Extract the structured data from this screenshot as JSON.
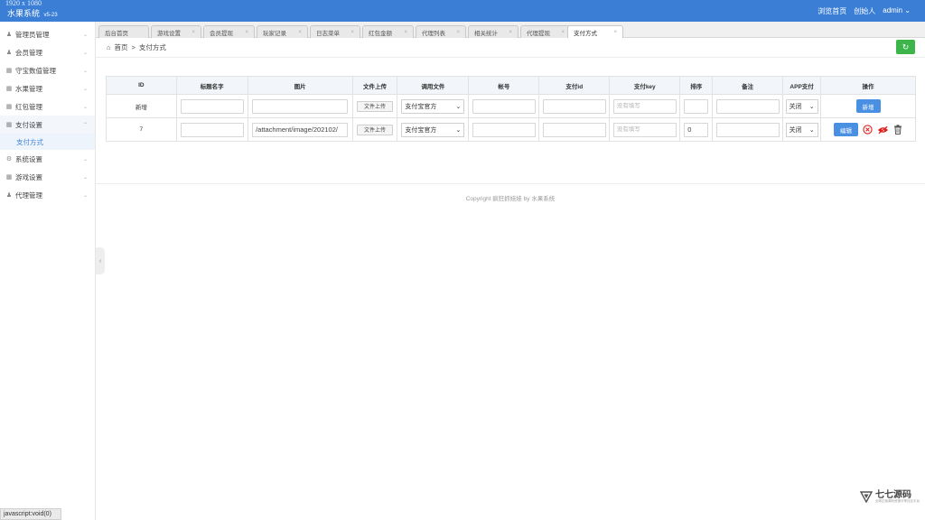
{
  "window": {
    "resolution": "1920  x  1080"
  },
  "brand": {
    "name": "水果系统",
    "version": "v5-23"
  },
  "topnav": {
    "browse_home": "浏览首页",
    "founder": "创始人",
    "user": "admin"
  },
  "sidebar": {
    "items": [
      {
        "label": "管理员管理",
        "icon": "user-icon"
      },
      {
        "label": "会员管理",
        "icon": "user-icon"
      },
      {
        "label": "守宝数值管理",
        "icon": "grid-icon"
      },
      {
        "label": "水果管理",
        "icon": "grid-icon"
      },
      {
        "label": "红包管理",
        "icon": "grid-icon"
      },
      {
        "label": "支付设置",
        "icon": "grid-icon"
      },
      {
        "label": "系统设置",
        "icon": "gear-icon"
      },
      {
        "label": "游戏设置",
        "icon": "grid-icon"
      },
      {
        "label": "代理管理",
        "icon": "user-icon"
      }
    ],
    "sub_active": "支付方式",
    "status_link": "javascript:void(0)"
  },
  "tabs": [
    "后台首页",
    "游戏设置",
    "会员提现",
    "玩家记录",
    "日志菜单",
    "红包金额",
    "代理列表",
    "相关统计",
    "代理提现",
    "支付方式"
  ],
  "breadcrumb": {
    "home": "首页",
    "sep": ">",
    "current": "支付方式"
  },
  "table": {
    "headers": [
      "ID",
      "标题名字",
      "图片",
      "文件上传",
      "调用文件",
      "帐号",
      "支付id",
      "支付key",
      "排序",
      "备注",
      "APP支付",
      "操作"
    ],
    "upload_label": "文件上传",
    "key_placeholder": "没有填写",
    "rows": [
      {
        "id": "新增",
        "title": "",
        "image": "",
        "call_file": "支付宝官方",
        "account": "",
        "pay_id": "",
        "sort": "",
        "remark": "",
        "app_pay": "关闭",
        "action": "新增"
      },
      {
        "id": "7",
        "title": "",
        "image": "/attachment/image/202102/",
        "call_file": "支付宝官方",
        "account": "",
        "pay_id": "",
        "sort": "0",
        "remark": "",
        "app_pay": "关闭",
        "action": "编辑"
      }
    ]
  },
  "footer": {
    "copyright": "Copyright 疯狂抓娃娃 by 水果系统"
  },
  "watermark": {
    "name": "七七源码",
    "sub": "全球正版源码资源分享社区平台"
  }
}
